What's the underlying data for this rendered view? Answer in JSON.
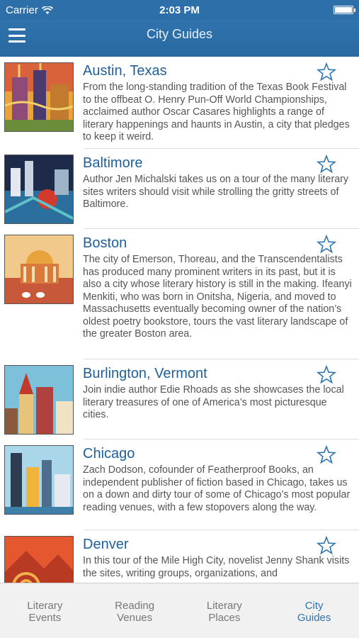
{
  "status": {
    "carrier": "Carrier",
    "time": "2:03 PM"
  },
  "nav": {
    "title": "City Guides"
  },
  "guides": [
    {
      "name": "Austin, Texas",
      "desc": "From the long-standing tradition of the Texas Book Festival to the offbeat O. Henry Pun-Off World Championships, acclaimed author Oscar Casares highlights a range of literary happenings and haunts in Austin, a city that pledges to keep it weird."
    },
    {
      "name": "Baltimore",
      "desc": "Author Jen Michalski takes us on a tour of the many literary sites writers should visit while strolling the gritty streets of Baltimore."
    },
    {
      "name": "Boston",
      "desc": "The city of Emerson, Thoreau, and the Transcendentalists has produced many prominent writers in its past, but it is also a city whose literary history is still in the making. Ifeanyi Menkiti, who was born in Onitsha, Nigeria, and moved to Massachusetts eventually becoming owner of the nation’s oldest poetry bookstore, tours the vast literary landscape of the greater Boston area."
    },
    {
      "name": "Burlington, Vermont",
      "desc": "Join indie author Edie Rhoads as she showcases the local literary treasures of one of America’s most picturesque cities."
    },
    {
      "name": "Chicago",
      "desc": "Zach Dodson, cofounder of Featherproof Books, an independent publisher of fiction based in Chicago, takes us on a down and dirty tour of some of Chicago’s most popular reading venues, with a few stopovers along the way."
    },
    {
      "name": "Denver",
      "desc": "In this tour of the Mile High City, novelist Jenny Shank visits the sites, writing groups, organizations, and"
    }
  ],
  "tabs": [
    {
      "label_line1": "Literary",
      "label_line2": "Events"
    },
    {
      "label_line1": "Reading",
      "label_line2": "Venues"
    },
    {
      "label_line1": "Literary",
      "label_line2": "Places"
    },
    {
      "label_line1": "City",
      "label_line2": "Guides"
    }
  ],
  "colors": {
    "accent": "#2f74ae",
    "title_blue": "#1f5f97"
  }
}
